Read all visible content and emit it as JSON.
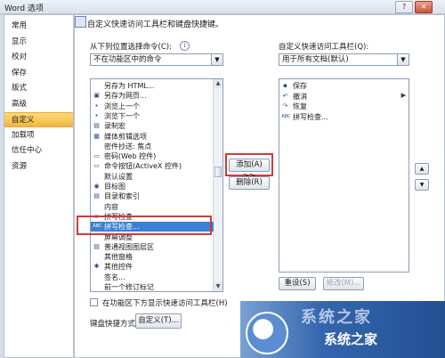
{
  "window": {
    "title": "Word 选项",
    "help": "?",
    "close": "✕"
  },
  "nav": {
    "items": [
      "常用",
      "显示",
      "校对",
      "保存",
      "版式",
      "高级",
      "自定义",
      "加载项",
      "信任中心",
      "资源"
    ],
    "selected_index": 6
  },
  "header": {
    "text": "自定义快速访问工具栏和键盘快捷键。"
  },
  "left": {
    "label": "从下列位置选择命令(C):",
    "info": "i",
    "dropdown_value": "不在功能区中的命令",
    "commands": [
      {
        "icon": "",
        "label": "另存为 HTML..."
      },
      {
        "icon": "▣",
        "label": "另存为网页..."
      },
      {
        "icon": "•",
        "label": "浏览上一个"
      },
      {
        "icon": "•",
        "label": "浏览下一个"
      },
      {
        "icon": "▤",
        "label": "录制宏"
      },
      {
        "icon": "▦",
        "label": "媒体剪辑选项"
      },
      {
        "icon": "",
        "label": "密件抄送: 焦点"
      },
      {
        "icon": "▭",
        "label": "密码(Web 控件)"
      },
      {
        "icon": "▭",
        "label": "命令按钮(ActiveX 控件)"
      },
      {
        "icon": "",
        "label": "默认设置"
      },
      {
        "icon": "◉",
        "label": "目标图"
      },
      {
        "icon": "▤",
        "label": "目录和索引"
      },
      {
        "icon": "",
        "label": "内容"
      },
      {
        "icon": "▫",
        "label": "拼写检查"
      },
      {
        "icon": "ABC",
        "label": "拼写检查..."
      },
      {
        "icon": "",
        "label": "屏幕调整"
      },
      {
        "icon": "▤",
        "label": "普通视图图层区"
      },
      {
        "icon": "",
        "label": "其他窗格"
      },
      {
        "icon": "✱",
        "label": "其他控件"
      },
      {
        "icon": "",
        "label": "签名..."
      },
      {
        "icon": "",
        "label": "前一个修订标记"
      }
    ],
    "selected_command": 14,
    "checkbox_label": "在功能区下方显示快速访问工具栏(H)",
    "shortcut_label": "键盘快捷方式:",
    "customize_button": "自定义(T)..."
  },
  "middle": {
    "add_button": "添加(A) >>",
    "remove_button": "删除(R)"
  },
  "right": {
    "label": "自定义快速访问工具栏(Q):",
    "dropdown_value": "用于所有文档(默认)",
    "items": [
      {
        "icon": "▪",
        "label": "保存"
      },
      {
        "icon": "↶",
        "label": "撤消"
      },
      {
        "icon": "↷",
        "label": "恢复"
      },
      {
        "icon": "ABC",
        "label": "拼写检查..."
      }
    ],
    "reset_button": "重设(S)",
    "modify_button": "修改(M)...",
    "move_up": "▲",
    "move_down": "▼"
  },
  "watermark": {
    "title": "系统之家",
    "brand": "系统之家"
  }
}
